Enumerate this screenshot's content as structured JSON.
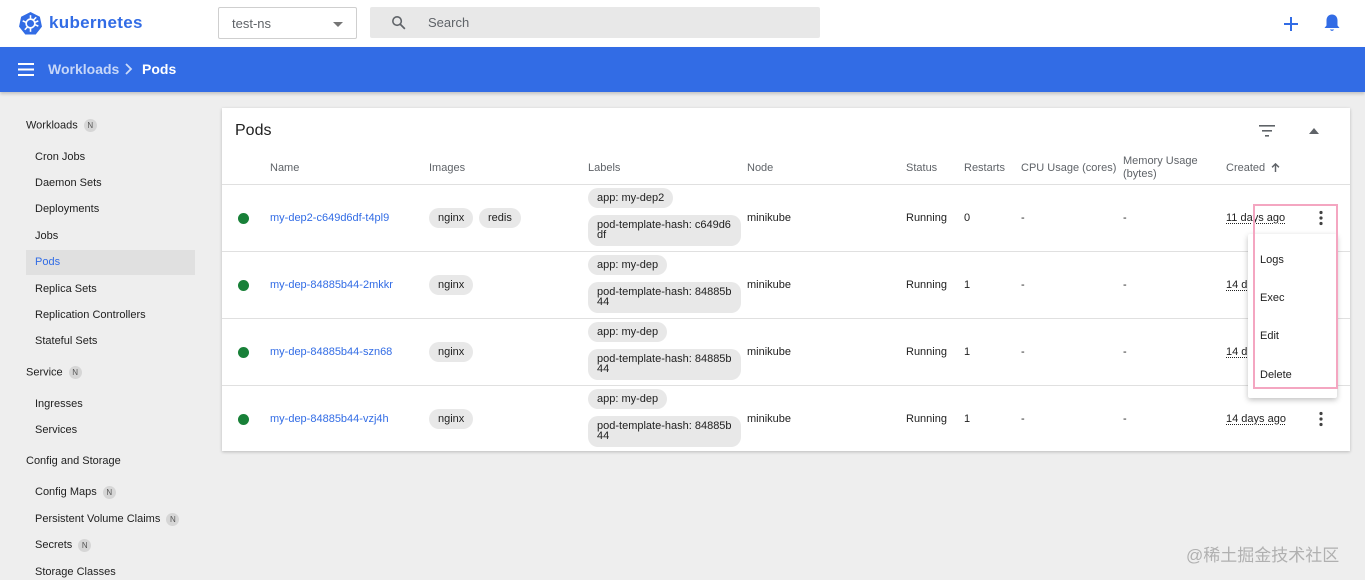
{
  "app": {
    "brand": "kubernetes"
  },
  "namespace": {
    "selected": "test-ns"
  },
  "search": {
    "placeholder": "Search"
  },
  "breadcrumb": {
    "parent": "Workloads",
    "current": "Pods"
  },
  "sidebar": {
    "workloads_title": "Workloads",
    "service_title": "Service",
    "config_title": "Config and Storage",
    "badge": "N",
    "workloads_items": [
      {
        "label": "Cron Jobs"
      },
      {
        "label": "Daemon Sets"
      },
      {
        "label": "Deployments"
      },
      {
        "label": "Jobs"
      },
      {
        "label": "Pods"
      },
      {
        "label": "Replica Sets"
      },
      {
        "label": "Replication Controllers"
      },
      {
        "label": "Stateful Sets"
      }
    ],
    "service_items": [
      {
        "label": "Ingresses"
      },
      {
        "label": "Services"
      }
    ],
    "config_items": [
      {
        "label": "Config Maps"
      },
      {
        "label": "Persistent Volume Claims"
      },
      {
        "label": "Secrets"
      },
      {
        "label": "Storage Classes"
      }
    ]
  },
  "pods": {
    "title": "Pods",
    "columns": {
      "name": "Name",
      "images": "Images",
      "labels": "Labels",
      "node": "Node",
      "status": "Status",
      "restarts": "Restarts",
      "cpu": "CPU Usage (cores)",
      "memory": "Memory Usage (bytes)",
      "created": "Created"
    },
    "rows": [
      {
        "name": "my-dep2-c649d6df-t4pl9",
        "images": [
          "nginx",
          "redis"
        ],
        "label_app": "app: my-dep2",
        "label_hash": "pod-template-hash: c649d6df",
        "node": "minikube",
        "status": "Running",
        "restarts": "0",
        "cpu": "-",
        "memory": "-",
        "created": "11 days ago"
      },
      {
        "name": "my-dep-84885b44-2mkkr",
        "images": [
          "nginx"
        ],
        "label_app": "app: my-dep",
        "label_hash": "pod-template-hash: 84885b44",
        "node": "minikube",
        "status": "Running",
        "restarts": "1",
        "cpu": "-",
        "memory": "-",
        "created": "14 d"
      },
      {
        "name": "my-dep-84885b44-szn68",
        "images": [
          "nginx"
        ],
        "label_app": "app: my-dep",
        "label_hash": "pod-template-hash: 84885b44",
        "node": "minikube",
        "status": "Running",
        "restarts": "1",
        "cpu": "-",
        "memory": "-",
        "created": "14 d"
      },
      {
        "name": "my-dep-84885b44-vzj4h",
        "images": [
          "nginx"
        ],
        "label_app": "app: my-dep",
        "label_hash": "pod-template-hash: 84885b44",
        "node": "minikube",
        "status": "Running",
        "restarts": "1",
        "cpu": "-",
        "memory": "-",
        "created": "14 days ago"
      }
    ]
  },
  "action_menu": {
    "items": [
      {
        "label": "Logs"
      },
      {
        "label": "Exec"
      },
      {
        "label": "Edit"
      },
      {
        "label": "Delete"
      }
    ]
  },
  "watermark": "@稀土掘金技术社区",
  "colors": {
    "primary": "#326ce5",
    "running": "#188038",
    "highlight": "#f4a6c1"
  }
}
